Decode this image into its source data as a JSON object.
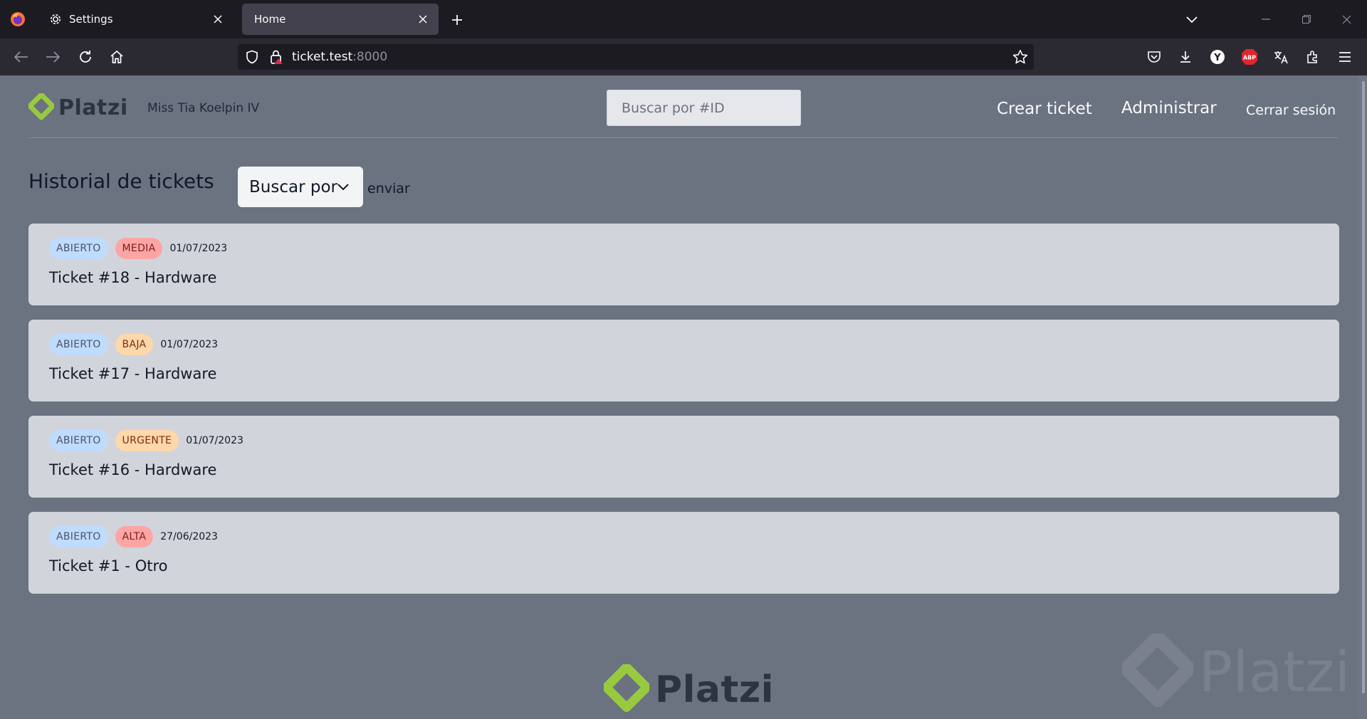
{
  "browser": {
    "tabs": [
      {
        "title": "Settings",
        "icon": "gear-icon",
        "active": false
      },
      {
        "title": "Home",
        "icon": "",
        "active": true
      }
    ],
    "url": {
      "host": "ticket.test",
      "port": ":8000"
    },
    "extensions": [
      "pocket-icon",
      "download-icon",
      "yandex-icon",
      "adblock-icon",
      "translate-icon",
      "extensions-icon",
      "menu-icon"
    ],
    "adblock_label": "ABP",
    "yandex_label": "Y"
  },
  "header": {
    "brand": "Platzi",
    "user_name": "Miss Tia Koelpin IV",
    "search_placeholder": "Buscar por #ID",
    "nav": {
      "crear": "Crear ticket",
      "administrar": "Administrar",
      "cerrar": "Cerrar sesión"
    }
  },
  "main": {
    "title": "Historial de tickets",
    "filter_select": "Buscar por",
    "submit_label": "enviar"
  },
  "tickets": [
    {
      "status": "ABIERTO",
      "priority": "MEDIA",
      "date": "01/07/2023",
      "title": "Ticket #18 - Hardware"
    },
    {
      "status": "ABIERTO",
      "priority": "BAJA",
      "date": "01/07/2023",
      "title": "Ticket #17 - Hardware"
    },
    {
      "status": "ABIERTO",
      "priority": "URGENTE",
      "date": "01/07/2023",
      "title": "Ticket #16 - Hardware"
    },
    {
      "status": "ABIERTO",
      "priority": "ALTA",
      "date": "27/06/2023",
      "title": "Ticket #1 - Otro"
    }
  ],
  "footer": {
    "brand": "Platzi"
  },
  "colors": {
    "page_bg": "#6b7280",
    "card_bg": "#d1d5db",
    "brand_green": "#98ca3f",
    "brand_dark": "#2b3440"
  }
}
